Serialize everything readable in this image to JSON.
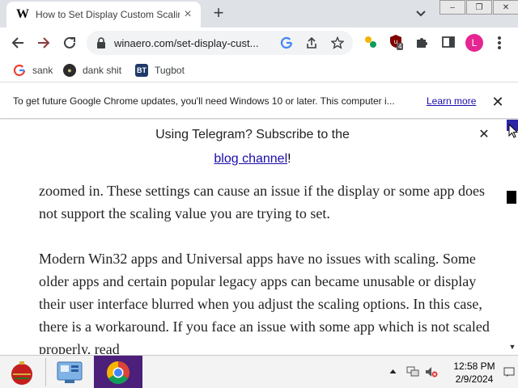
{
  "browser": {
    "tab": {
      "title": "How to Set Display Custom Scaling in Windows",
      "favicon_letter": "W"
    },
    "tab_close_icon": "×",
    "new_tab_icon": "+",
    "window_buttons": [
      "‒",
      "❐",
      "✕"
    ],
    "url": "winaero.com/set-display-cust...",
    "bookmarks": [
      {
        "label": "sank",
        "icon": "google-icon"
      },
      {
        "label": "dank shit",
        "icon": "site-icon"
      },
      {
        "label": "Tugbot",
        "icon": "BT"
      }
    ],
    "avatar_letter": "L",
    "extension_badge": "4",
    "accent_color": "#e52592"
  },
  "infobar": {
    "message": "To get future Google Chrome updates, you'll need Windows 10 or later. This computer i...",
    "link": "Learn more",
    "close_icon": "✕"
  },
  "page": {
    "banner_line1": "Using Telegram? Subscribe to the",
    "banner_link": "blog channel",
    "banner_suffix": "!",
    "banner_close_icon": "✕",
    "paragraphs": [
      "zoomed in. These settings can cause an issue if the display or some app does not support the scaling value you are trying to set.",
      "Modern Win32 apps and Universal apps have no issues with scaling. Some older apps and certain popular legacy apps can became unusable or display their user interface blurred when you adjust the scaling options. In this case, there is a workaround. If you face an issue with some app which is not scaled properly, read"
    ]
  },
  "scrollbar": {
    "down_icon": "▼"
  },
  "taskbar": {
    "apps": [
      "start-button",
      "control-panel",
      "chrome"
    ],
    "clock_time": "12:58 PM",
    "clock_date": "2/9/2024"
  }
}
